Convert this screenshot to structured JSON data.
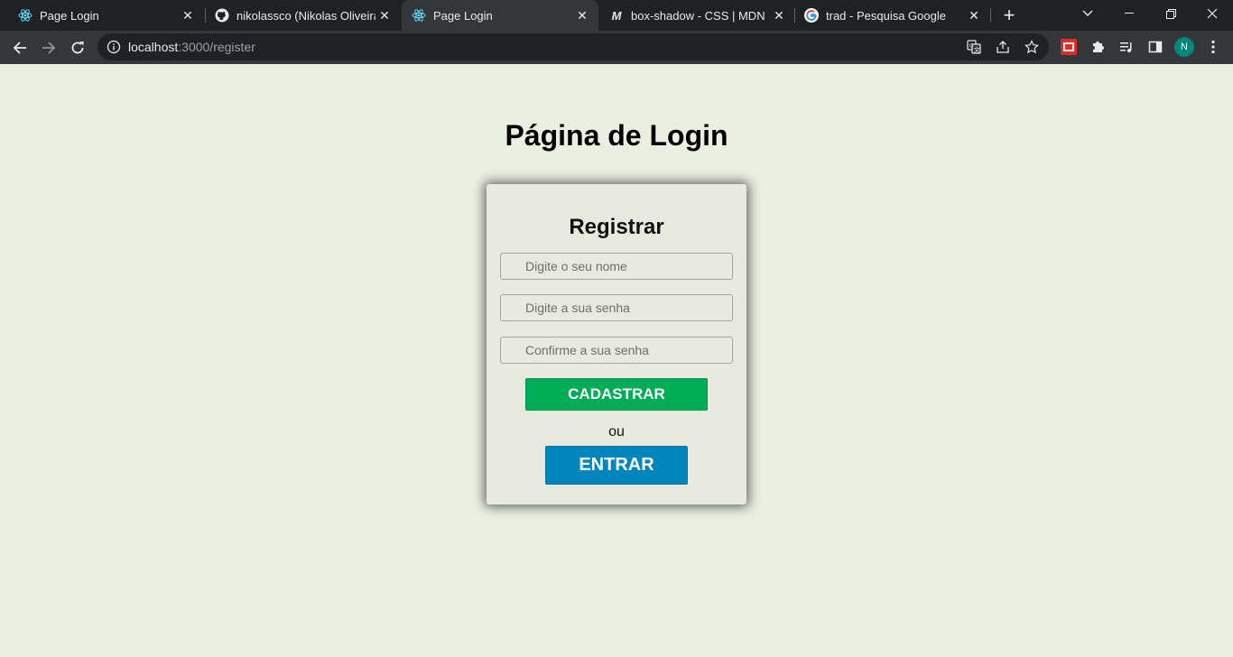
{
  "browser": {
    "tabs": [
      {
        "title": "Page Login",
        "icon": "react-icon",
        "active": false
      },
      {
        "title": "nikolassco (Nikolas Oliveira)",
        "icon": "github-icon",
        "active": false
      },
      {
        "title": "Page Login",
        "icon": "react-icon",
        "active": true
      },
      {
        "title": "box-shadow - CSS | MDN",
        "icon": "mdn-icon",
        "active": false
      },
      {
        "title": "trad - Pesquisa Google",
        "icon": "google-icon",
        "active": false
      }
    ],
    "url_host": "localhost",
    "url_rest": ":3000/register",
    "profile_initial": "N"
  },
  "page": {
    "heading": "Página de Login",
    "form": {
      "title": "Registrar",
      "name_placeholder": "Digite o seu nome",
      "password_placeholder": "Digite a sua senha",
      "confirm_placeholder": "Confirme a sua senha",
      "register_label": "CADASTRAR",
      "separator_text": "ou",
      "login_label": "ENTRAR"
    }
  },
  "colors": {
    "page_background": "#ebefe1",
    "card_background": "#e9eadf",
    "register_button": "#00ad56",
    "login_button": "#0086bc",
    "profile_avatar": "#00897b"
  }
}
